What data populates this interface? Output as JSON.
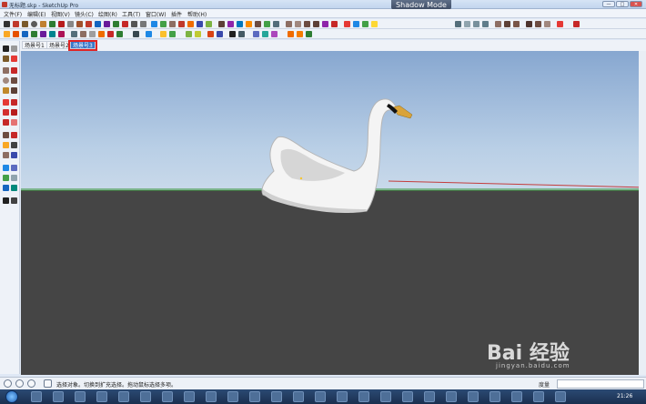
{
  "window": {
    "title": "无标题.skp - SketchUp Pro",
    "shadow_mode_label": "Shadow Mode",
    "controls": [
      "—",
      "□",
      "✕"
    ]
  },
  "menubar": {
    "items": [
      "文件(F)",
      "编辑(E)",
      "视图(V)",
      "镜头(C)",
      "绘图(R)",
      "工具(T)",
      "窗口(W)",
      "插件",
      "帮助(H)"
    ]
  },
  "scene_tabs": {
    "items": [
      "场景号1",
      "场景号2",
      "场景号3"
    ],
    "active_index": 2
  },
  "statusbar": {
    "hint": "选择对象。切换到扩充选择。拖动鼠标选择多项。",
    "measure_label": "度量"
  },
  "taskbar": {
    "time": "21:26"
  },
  "watermark": {
    "brand": "Bai 经验",
    "url": "jingyan.baidu.com"
  },
  "colors": {
    "sky_top": "#87a7d0",
    "ground": "#454545",
    "active_tab": "#3a78c8",
    "highlight": "#e02424"
  }
}
